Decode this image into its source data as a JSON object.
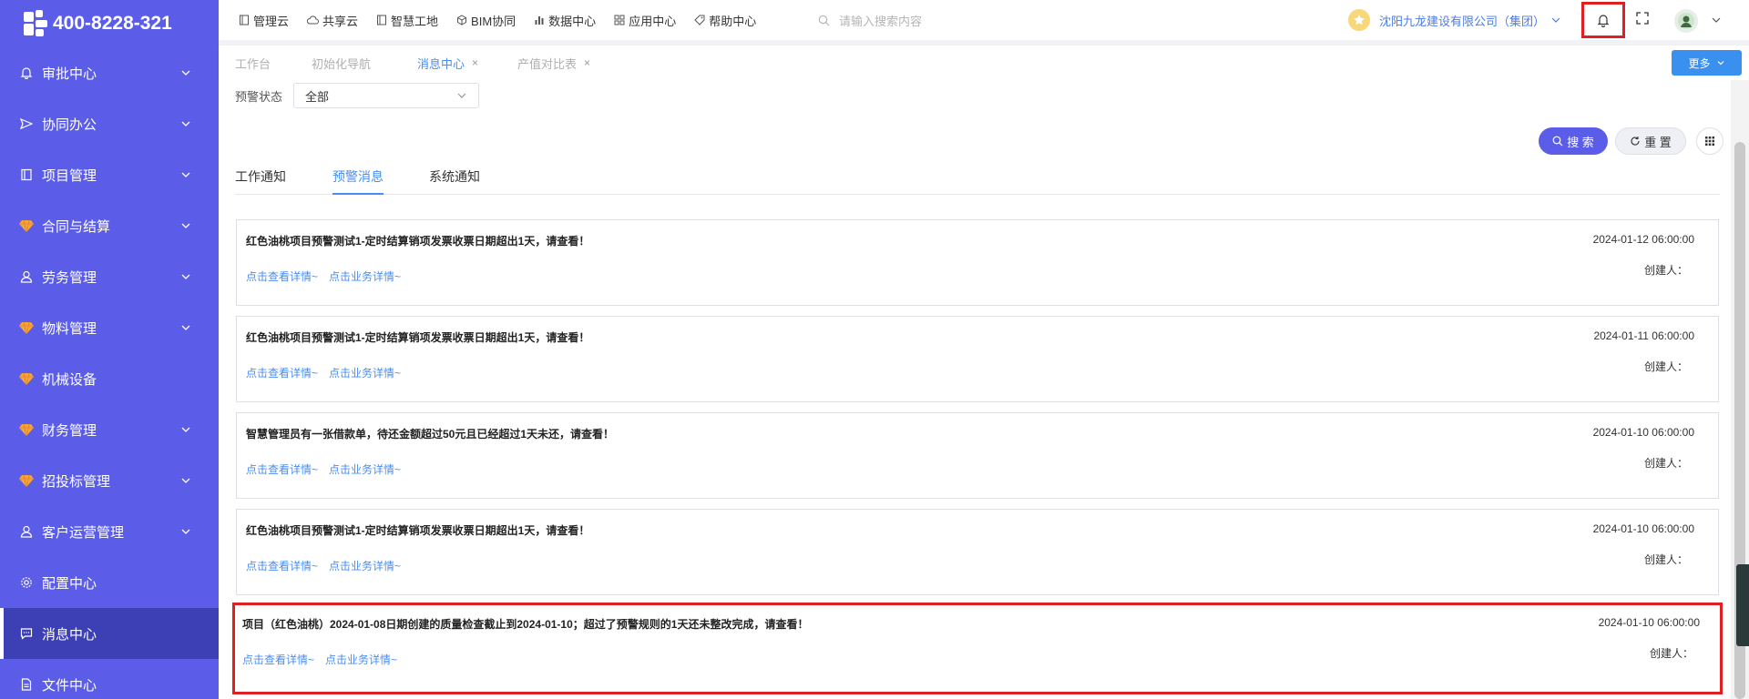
{
  "brand": {
    "phone": "400-8228-321"
  },
  "sidebar": {
    "items": [
      {
        "label": "审批中心",
        "icon": "bell-icon",
        "has_children": true
      },
      {
        "label": "协同办公",
        "icon": "send-icon",
        "has_children": true
      },
      {
        "label": "项目管理",
        "icon": "book-icon",
        "has_children": true
      },
      {
        "label": "合同与结算",
        "icon": "gem-icon",
        "has_children": true
      },
      {
        "label": "劳务管理",
        "icon": "user-icon",
        "has_children": true
      },
      {
        "label": "物料管理",
        "icon": "gem-icon",
        "has_children": true
      },
      {
        "label": "机械设备",
        "icon": "gem-icon",
        "has_children": false
      },
      {
        "label": "财务管理",
        "icon": "gem-icon",
        "has_children": true
      },
      {
        "label": "招投标管理",
        "icon": "gem-icon",
        "has_children": true
      },
      {
        "label": "客户运营管理",
        "icon": "user-icon",
        "has_children": true
      },
      {
        "label": "配置中心",
        "icon": "gear-icon",
        "has_children": false
      },
      {
        "label": "消息中心",
        "icon": "message-icon",
        "has_children": false,
        "active": true
      },
      {
        "label": "文件中心",
        "icon": "file-icon",
        "has_children": false
      }
    ]
  },
  "topnav": {
    "items": [
      {
        "label": "管理云",
        "icon": "book-icon"
      },
      {
        "label": "共享云",
        "icon": "cloud-icon"
      },
      {
        "label": "智慧工地",
        "icon": "book-icon"
      },
      {
        "label": "BIM协同",
        "icon": "cube-icon"
      },
      {
        "label": "数据中心",
        "icon": "bar-chart-icon"
      },
      {
        "label": "应用中心",
        "icon": "apps-icon"
      },
      {
        "label": "帮助中心",
        "icon": "tag-icon"
      }
    ],
    "search_placeholder": "请输入搜索内容",
    "company": "沈阳九龙建设有限公司（集团）"
  },
  "tabs": [
    {
      "label": "工作台",
      "closable": false
    },
    {
      "label": "初始化导航",
      "closable": false
    },
    {
      "label": "消息中心",
      "closable": true,
      "active": true
    },
    {
      "label": "产值对比表",
      "closable": true
    }
  ],
  "more_button": "更多",
  "filter": {
    "label": "预警状态",
    "value": "全部"
  },
  "buttons": {
    "search": "搜 索",
    "reset": "重 置"
  },
  "message_tabs": [
    {
      "label": "工作通知"
    },
    {
      "label": "预警消息",
      "active": true
    },
    {
      "label": "系统通知"
    }
  ],
  "messages": [
    {
      "title": "红色油桃项目预警测试1-定时结算销项发票收票日期超出1天，请查看！",
      "date": "2024-01-12 06:00:00",
      "creator": "创建人：",
      "link1": "点击查看详情~",
      "link2": "点击业务详情~"
    },
    {
      "title": "红色油桃项目预警测试1-定时结算销项发票收票日期超出1天，请查看！",
      "date": "2024-01-11 06:00:00",
      "creator": "创建人：",
      "link1": "点击查看详情~",
      "link2": "点击业务详情~"
    },
    {
      "title": "智慧管理员有一张借款单，待还金额超过50元且已经超过1天未还，请查看！",
      "date": "2024-01-10 06:00:00",
      "creator": "创建人：",
      "link1": "点击查看详情~",
      "link2": "点击业务详情~"
    },
    {
      "title": "红色油桃项目预警测试1-定时结算销项发票收票日期超出1天，请查看！",
      "date": "2024-01-10 06:00:00",
      "creator": "创建人：",
      "link1": "点击查看详情~",
      "link2": "点击业务详情~"
    },
    {
      "title": "项目（红色油桃）2024-01-08日期创建的质量检查截止到2024-01-10；超过了预警规则的1天还未整改完成，请查看！",
      "date": "2024-01-10 06:00:00",
      "creator": "创建人：",
      "link1": "点击查看详情~",
      "link2": "点击业务详情~",
      "highlighted": true
    }
  ],
  "colors": {
    "sidebar": "#5b5de8",
    "sidebar_active": "#3d3fb5",
    "link": "#4a8df0",
    "highlight": "#e02020"
  }
}
